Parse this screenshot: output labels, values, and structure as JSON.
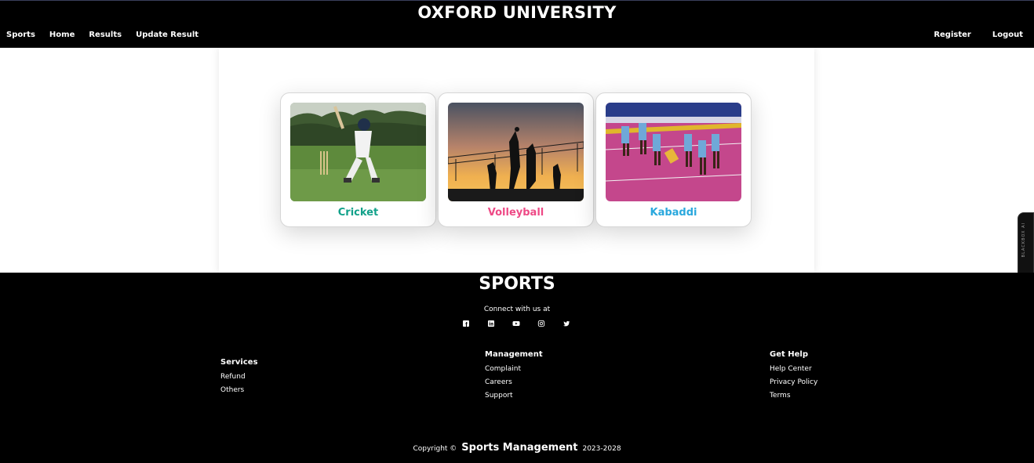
{
  "header": {
    "title": "OXFORD UNIVERSITY",
    "nav_left": [
      "Sports",
      "Home",
      "Results",
      "Update Result"
    ],
    "nav_right": [
      "Register",
      "Logout"
    ]
  },
  "cards": [
    {
      "label": "Cricket",
      "color": "#12a18a"
    },
    {
      "label": "Volleyball",
      "color": "#ee4a86"
    },
    {
      "label": "Kabaddi",
      "color": "#2aa8dd"
    }
  ],
  "side_widget": {
    "label": "BLACKBOX AI"
  },
  "footer": {
    "title": "SPORTS",
    "connect_text": "Connect with us at",
    "social_icons": [
      "facebook-icon",
      "linkedin-icon",
      "youtube-icon",
      "instagram-icon",
      "twitter-icon"
    ],
    "columns": [
      {
        "title": "Services",
        "links": [
          "Refund",
          "Others"
        ]
      },
      {
        "title": "Management",
        "links": [
          "Complaint",
          "Careers",
          "Support"
        ]
      },
      {
        "title": "Get Help",
        "links": [
          "Help Center",
          "Privacy Policy",
          "Terms"
        ]
      }
    ],
    "copyright": {
      "prefix": "Copyright ©",
      "brand": "Sports Management",
      "years": "2023-2028"
    }
  }
}
